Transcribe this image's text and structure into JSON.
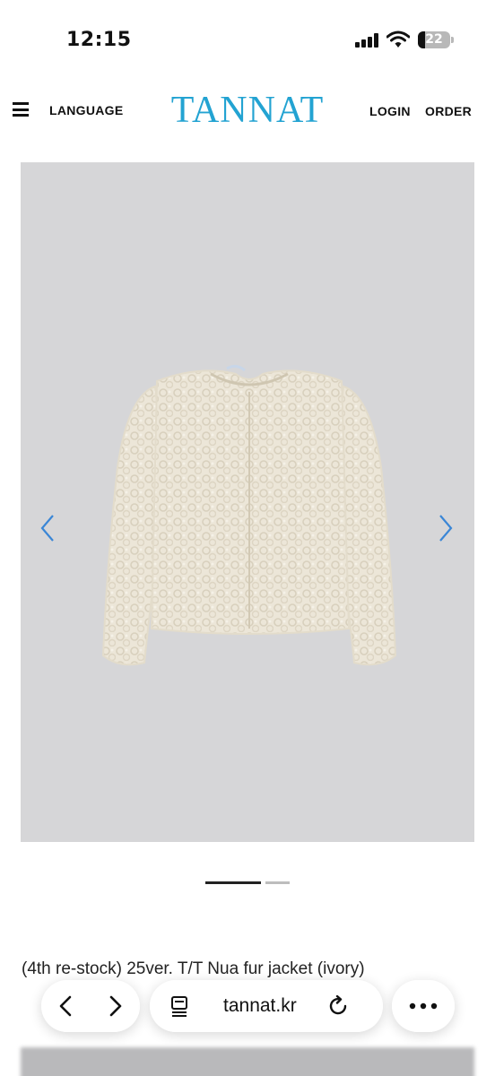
{
  "status_bar": {
    "time": "12:15",
    "battery_level": "22"
  },
  "header": {
    "language_label": "LANGUAGE",
    "logo_text": "TANNAT",
    "login_label": "LOGIN",
    "order_label": "ORDER",
    "brand_color": "#23a3d2"
  },
  "carousel": {
    "current_slide": 1,
    "total_slides": 2,
    "image_icon": "fur-jacket-image"
  },
  "product": {
    "title": "(4th re-stock) 25ver. T/T Nua fur jacket (ivory)"
  },
  "browser": {
    "url": "tannat.kr",
    "icons": [
      "back-icon",
      "forward-icon",
      "tabs-icon",
      "reload-icon",
      "more-icon"
    ]
  }
}
